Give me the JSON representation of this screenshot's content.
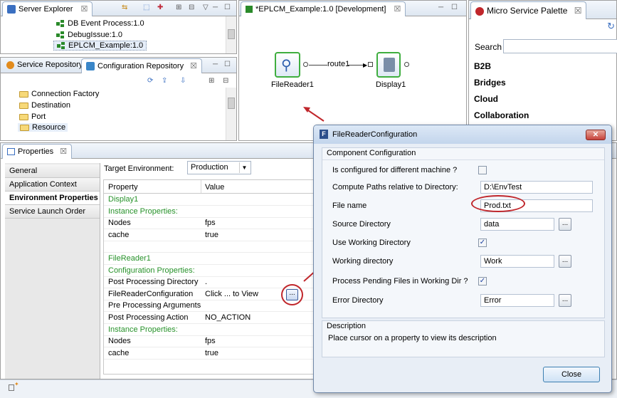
{
  "server_explorer": {
    "tab_label": "Server Explorer",
    "items": [
      "DB Event Process:1.0",
      "DebugIssue:1.0",
      "EPLCM_Example:1.0"
    ]
  },
  "repo_panel": {
    "tab_service": "Service Repository",
    "tab_config": "Configuration Repository",
    "items": [
      "Connection Factory",
      "Destination",
      "Port",
      "Resource"
    ]
  },
  "editor": {
    "tab_label": "*EPLCM_Example:1.0 [Development]",
    "node_source": "FileReader1",
    "node_target": "Display1",
    "route_label": "route1"
  },
  "palette": {
    "tab_label": "Micro Service Palette",
    "search_label": "Search",
    "categories": [
      "B2B",
      "Bridges",
      "Cloud",
      "Collaboration"
    ]
  },
  "properties": {
    "tab_label": "Properties",
    "side_items": [
      "General",
      "Application Context",
      "Environment Properties",
      "Service Launch Order"
    ],
    "target_env_label": "Target Environment:",
    "target_env_value": "Production",
    "col_property": "Property",
    "col_value": "Value",
    "rows": [
      {
        "p": "Display1",
        "v": "",
        "kind": "green"
      },
      {
        "p": "Instance Properties:",
        "v": "",
        "kind": "green-indent"
      },
      {
        "p": "Nodes",
        "v": "fps",
        "kind": "normal"
      },
      {
        "p": "cache",
        "v": "true",
        "kind": "normal"
      },
      {
        "p": "",
        "v": "",
        "kind": "normal"
      },
      {
        "p": "FileReader1",
        "v": "",
        "kind": "green"
      },
      {
        "p": "Configuration Properties:",
        "v": "",
        "kind": "green-indent"
      },
      {
        "p": "Post Processing Directory",
        "v": ".",
        "kind": "normal"
      },
      {
        "p": "FileReaderConfiguration",
        "v": "Click ... to View",
        "kind": "normal"
      },
      {
        "p": "Pre Processing Arguments",
        "v": "",
        "kind": "normal"
      },
      {
        "p": "Post Processing Action",
        "v": "NO_ACTION",
        "kind": "normal"
      },
      {
        "p": "Instance Properties:",
        "v": "",
        "kind": "green-indent"
      },
      {
        "p": "Nodes",
        "v": "fps",
        "kind": "normal"
      },
      {
        "p": "cache",
        "v": "true",
        "kind": "normal"
      }
    ],
    "ellipsis": "..."
  },
  "dialog": {
    "title": "FileReaderConfiguration",
    "section_title": "Component Configuration",
    "fields": [
      {
        "label": "Is configured for different machine ?",
        "type": "checkbox",
        "checked": false
      },
      {
        "label": "Compute Paths relative to Directory:",
        "type": "text",
        "value": "D:\\EnvTest"
      },
      {
        "label": "File name",
        "type": "text",
        "value": "Prod.txt"
      },
      {
        "label": "Source Directory",
        "type": "browse",
        "value": "data"
      },
      {
        "label": "Use Working Directory",
        "type": "checkbox",
        "checked": true
      },
      {
        "label": "Working directory",
        "type": "browse",
        "value": "Work"
      },
      {
        "label": "Process Pending Files in Working Dir ?",
        "type": "checkbox",
        "checked": true
      },
      {
        "label": "Error Directory",
        "type": "browse",
        "value": "Error"
      }
    ],
    "browse_label": "...",
    "description_title": "Description",
    "description_text": "Place cursor on a property to view its description",
    "close_label": "Close"
  },
  "colors": {
    "accent_red": "#c0262b",
    "green_text": "#27922a",
    "dialog_title_bg": "#c9daf0"
  }
}
